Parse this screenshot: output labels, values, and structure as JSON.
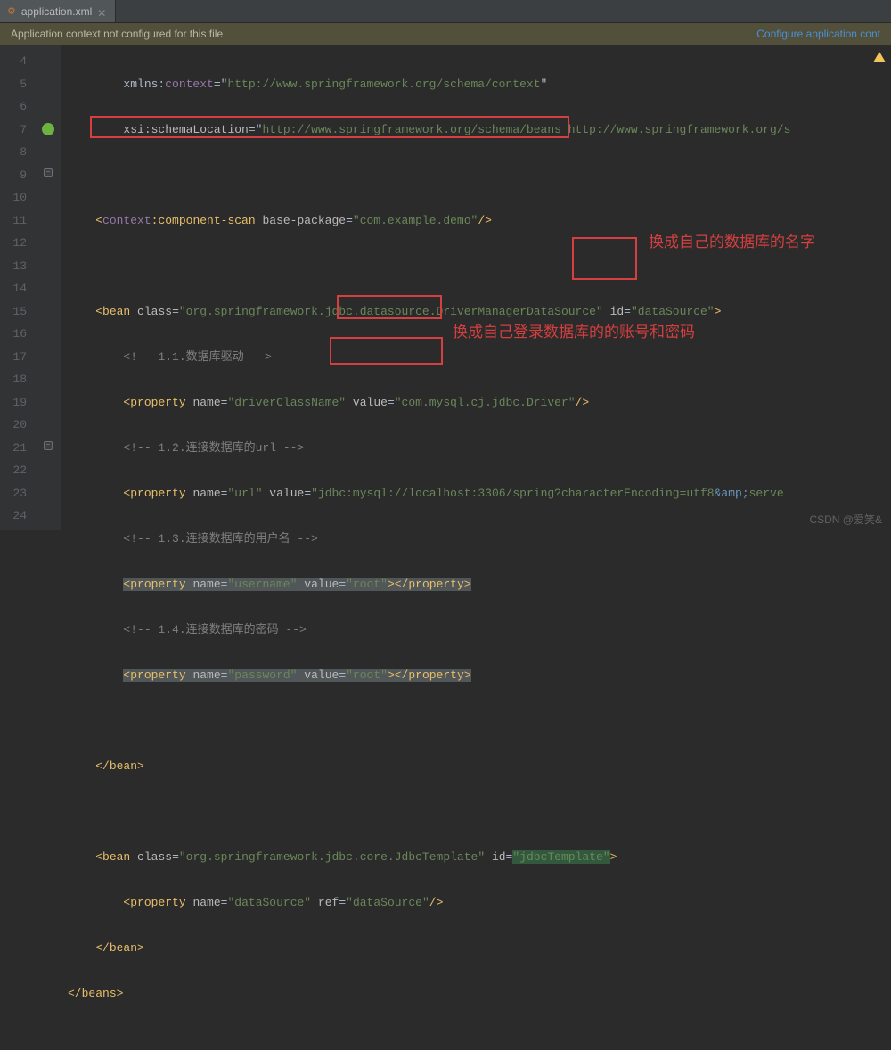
{
  "tab": {
    "filename": "application.xml"
  },
  "notice": {
    "text": "Application context not configured for this file",
    "action": "Configure application cont"
  },
  "gutter": {
    "start": 4,
    "end": 24
  },
  "code": {
    "l4_pre": "        xmlns:",
    "l4_ns": "context",
    "l4_eq": "=\"",
    "l4_url": "http://www.springframework.org/schema/context",
    "l4_end": "\"",
    "l5_pre": "        ",
    "l5_attr": "xsi:schemaLocation",
    "l5_eq": "=\"",
    "l5_url": "http://www.springframework.org/schema/beans http://www.springframework.org/s",
    "l7_indent": "    ",
    "l7_lt": "<",
    "l7_ns": "context",
    "l7_tag": ":component-scan",
    "l7_attr": " base-package",
    "l7_eq": "=",
    "l7_val": "\"com.example.demo\"",
    "l7_end": "/>",
    "l9_indent": "    ",
    "l9_lt": "<",
    "l9_tag": "bean",
    "l9_attr1": " class",
    "l9_val1": "\"org.springframework.jdbc.datasource.DriverManagerDataSource\"",
    "l9_attr2": " id",
    "l9_val2": "\"dataSource\"",
    "l9_end": ">",
    "l10": "        <!-- 1.1.数据库驱动 -->",
    "l11_indent": "        ",
    "l11_lt": "<",
    "l11_tag": "property",
    "l11_a1": " name",
    "l11_v1": "\"driverClassName\"",
    "l11_a2": " value",
    "l11_v2": "\"com.mysql.cj.jdbc.Driver\"",
    "l11_end": "/>",
    "l12": "        <!-- 1.2.连接数据库的url -->",
    "l13_indent": "        ",
    "l13_lt": "<",
    "l13_tag": "property",
    "l13_a1": " name",
    "l13_v1": "\"url\"",
    "l13_a2": " value",
    "l13_v2a": "\"jdbc:mysql://localhost:3306/spring?characterEncoding=utf8",
    "l13_amp": "&amp;",
    "l13_v2b": "serve",
    "l14": "        <!-- 1.3.连接数据库的用户名 -->",
    "l15_indent": "        ",
    "l15_lt": "<",
    "l15_tag": "property",
    "l15_a1": " name",
    "l15_v1": "\"username\"",
    "l15_a2": " value",
    "l15_v2": "\"root\"",
    "l15_mid": ">",
    "l15_ct": "</",
    "l15_tag2": "property",
    "l15_end": ">",
    "l16": "        <!-- 1.4.连接数据库的密码 -->",
    "l17_indent": "        ",
    "l17_lt": "<",
    "l17_tag": "property",
    "l17_a1": " name",
    "l17_v1": "\"password\"",
    "l17_a2": " value",
    "l17_v2": "\"root\"",
    "l17_mid": ">",
    "l17_ct": "</",
    "l17_tag2": "property",
    "l17_end": ">",
    "l19": "    </",
    "l19_tag": "bean",
    "l19_end": ">",
    "l21_indent": "    ",
    "l21_lt": "<",
    "l21_tag": "bean",
    "l21_a1": " class",
    "l21_v1": "\"org.springframework.jdbc.core.JdbcTemplate\"",
    "l21_a2": " id",
    "l21_v2": "\"jdbcTemplate\"",
    "l21_end": ">",
    "l22_indent": "        ",
    "l22_lt": "<",
    "l22_tag": "property",
    "l22_a1": " name",
    "l22_v1": "\"dataSource\"",
    "l22_a2": " ref",
    "l22_v2": "\"dataSource\"",
    "l22_end": "/>",
    "l23": "    </",
    "l23_tag": "bean",
    "l23_end": ">",
    "l24": "</",
    "l24_tag": "beans",
    "l24_end": ">"
  },
  "annotations": {
    "db_name": "换成自己的数据库的名字",
    "user_pwd": "换成自己登录数据库的的账号和密码"
  },
  "watermark": "CSDN @爱笑&"
}
